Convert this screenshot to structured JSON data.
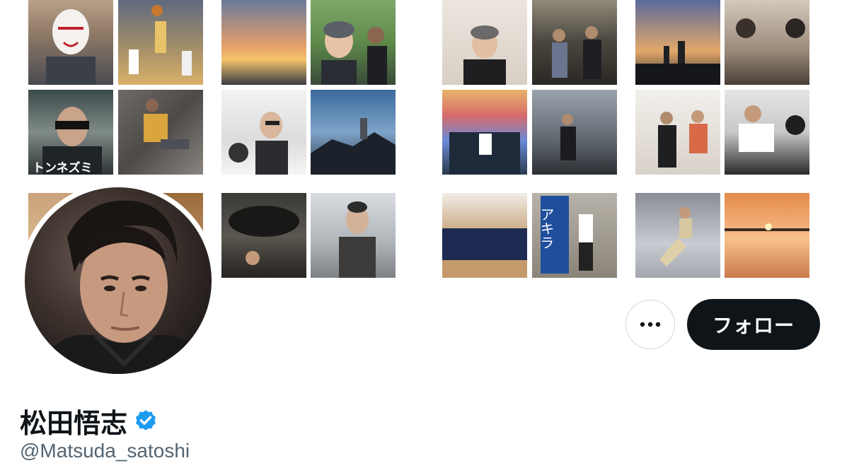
{
  "profile": {
    "display_name": "松田悟志",
    "handle": "@Matsuda_satoshi",
    "verified": true
  },
  "actions": {
    "more_icon": "more-horizontal-icon",
    "follow_label": "フォロー"
  },
  "banner": {
    "tile_labels": [
      "トンネズミ",
      "アキラ"
    ]
  },
  "colors": {
    "follow_bg": "#0f1419",
    "verified_blue": "#1d9bf0",
    "handle_gray": "#536471"
  }
}
